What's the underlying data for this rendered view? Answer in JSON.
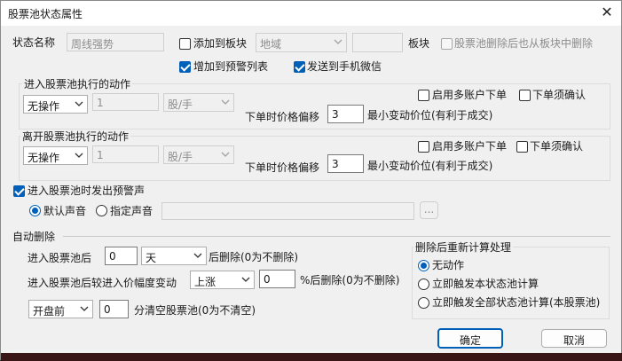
{
  "window": {
    "title": "股票池状态属性",
    "close_glyph": "✕"
  },
  "status_name": {
    "label": "状态名称",
    "value": "周线强势"
  },
  "add_to_block": {
    "label": "添加到板块",
    "checked": false,
    "combo_value": "地域",
    "block_label": "板块"
  },
  "remove_from_block": {
    "label": "股票池删除后也从板块中删除",
    "checked": false
  },
  "add_to_warning": {
    "label": "增加到预警列表",
    "checked": true
  },
  "send_to_wechat": {
    "label": "发送到手机微信",
    "checked": true
  },
  "enter_group": {
    "title": "进入股票池执行的动作",
    "action": "无操作",
    "qty": "1",
    "unit": "股/手",
    "multi_account": "启用多账户下单",
    "confirm": "下单须确认",
    "price_offset_label": "下单时价格偏移",
    "price_offset_value": "3",
    "min_tick_label": "最小变动价位(有利于成交)"
  },
  "leave_group": {
    "title": "离开股票池执行的动作",
    "action": "无操作",
    "qty": "1",
    "unit": "股/手",
    "multi_account": "启用多账户下单",
    "confirm": "下单须确认",
    "price_offset_label": "下单时价格偏移",
    "price_offset_value": "3",
    "min_tick_label": "最小变动价位(有利于成交)"
  },
  "warning_sound": {
    "label": "进入股票池时发出预警声",
    "checked": true,
    "default_label": "默认声音",
    "custom_label": "指定声音",
    "browse": "..."
  },
  "auto_delete": {
    "title": "自动删除",
    "row1": {
      "prefix": "进入股票池后",
      "value": "0",
      "unit": "天",
      "suffix": "后删除(0为不删除)"
    },
    "row2": {
      "prefix": "进入股票池后较进入价幅度变动",
      "direction": "上涨",
      "value": "0",
      "suffix": "%后删除(0为不删除)"
    },
    "row3": {
      "when": "开盘前",
      "value": "0",
      "suffix": "分清空股票池(0为不清空)"
    }
  },
  "recalc": {
    "title": "删除后重新计算处理",
    "options": [
      "无动作",
      "立即触发本状态池计算",
      "立即触发全部状态池计算(本股票池)"
    ],
    "selected": 0
  },
  "buttons": {
    "ok": "确定",
    "cancel": "取消"
  },
  "colors": {
    "accent": "#005fb8"
  }
}
